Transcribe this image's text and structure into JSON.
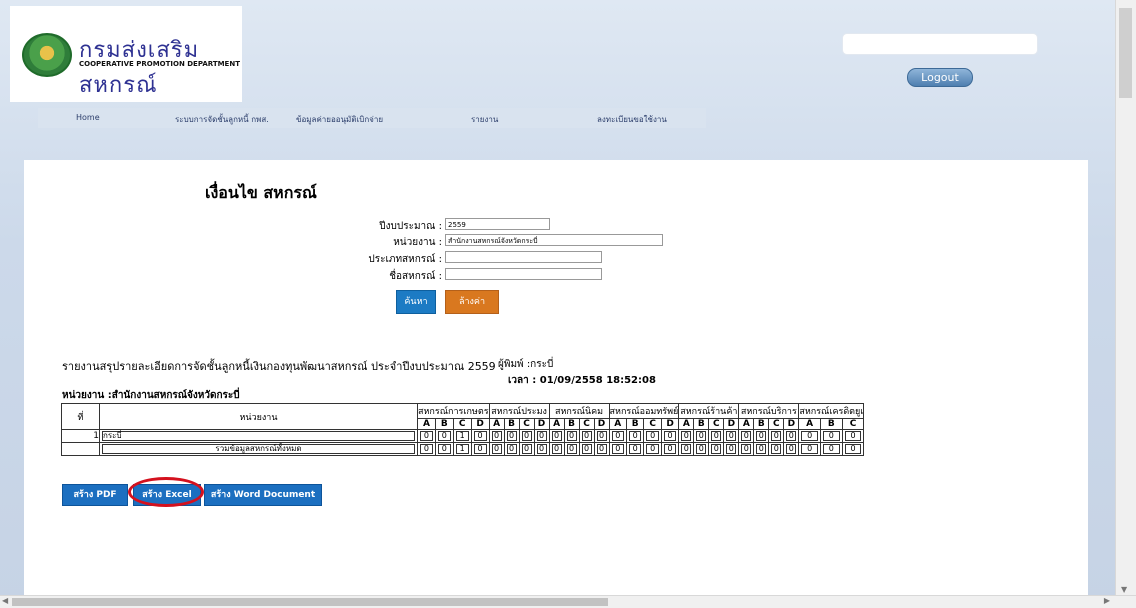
{
  "header": {
    "logo_title": "กรมส่งเสริมสหกรณ์",
    "logo_subtitle": "COOPERATIVE PROMOTION DEPARTMENT",
    "logout_label": "Logout"
  },
  "nav": {
    "items": [
      "Home",
      "ระบบการจัดชั้นลูกหนี้ กพส.",
      "ข้อมูลค่ายออนุมัติเบิกจ่าย",
      "รายงาน",
      "ลงทะเบียนขอใช้งาน"
    ]
  },
  "form": {
    "title": "เงื่อนไข สหกรณ์",
    "fields": [
      {
        "label": "ปีงบประมาณ :",
        "value": "2559"
      },
      {
        "label": "หน่วยงาน :",
        "value": "สำนักงานสหกรณ์จังหวัดกระบี่"
      },
      {
        "label": "ประเภทสหกรณ์ :",
        "value": ""
      },
      {
        "label": "ชื่อสหกรณ์ :",
        "value": ""
      }
    ],
    "search_label": "ค้นหา",
    "clear_label": "ล้างค่า"
  },
  "report": {
    "title": "รายงานสรุปรายละเอียดการจัดชั้นลูกหนี้เงินกองทุนพัฒนาสหกรณ์ ประจำปีงบประมาณ 2559",
    "printer": "ผู้พิมพ์ :กระบี่",
    "time": "เวลา : 01/09/2558 18:52:08",
    "unit": "หน่วยงาน :สำนักงานสหกรณ์จังหวัดกระบี่",
    "col_no": "ที่",
    "col_unit": "หน่วยงาน",
    "groups": [
      "สหกรณ์การเกษตร",
      "สหกรณ์ประมง",
      "สหกรณ์นิคม",
      "สหกรณ์ออมทรัพย์",
      "สหกรณ์ร้านค้า",
      "สหกรณ์บริการ",
      "สหกรณ์เครดิตยูเ"
    ],
    "grades": [
      "A",
      "B",
      "C",
      "D"
    ],
    "rows": [
      {
        "no": "1",
        "name": "กระบี่",
        "values": [
          "0",
          "0",
          "1",
          "0",
          "0",
          "0",
          "0",
          "0",
          "0",
          "0",
          "0",
          "0",
          "0",
          "0",
          "0",
          "0",
          "0",
          "0",
          "0",
          "0",
          "0",
          "0",
          "0",
          "0",
          "0",
          "0",
          "0"
        ]
      },
      {
        "no": "",
        "name": "รวมข้อมูลสหกรณ์ทั้งหมด",
        "values": [
          "0",
          "0",
          "1",
          "0",
          "0",
          "0",
          "0",
          "0",
          "0",
          "0",
          "0",
          "0",
          "0",
          "0",
          "0",
          "0",
          "0",
          "0",
          "0",
          "0",
          "0",
          "0",
          "0",
          "0",
          "0",
          "0",
          "0"
        ]
      }
    ]
  },
  "export": {
    "pdf_label": "สร้าง PDF",
    "excel_label": "สร้าง Excel",
    "word_label": "สร้าง Word Document"
  },
  "colors": {
    "search_button": "#1c7bc4",
    "clear_button": "#d9781f",
    "export_button": "#1c6fc0",
    "highlight_oval": "#d4111e"
  }
}
